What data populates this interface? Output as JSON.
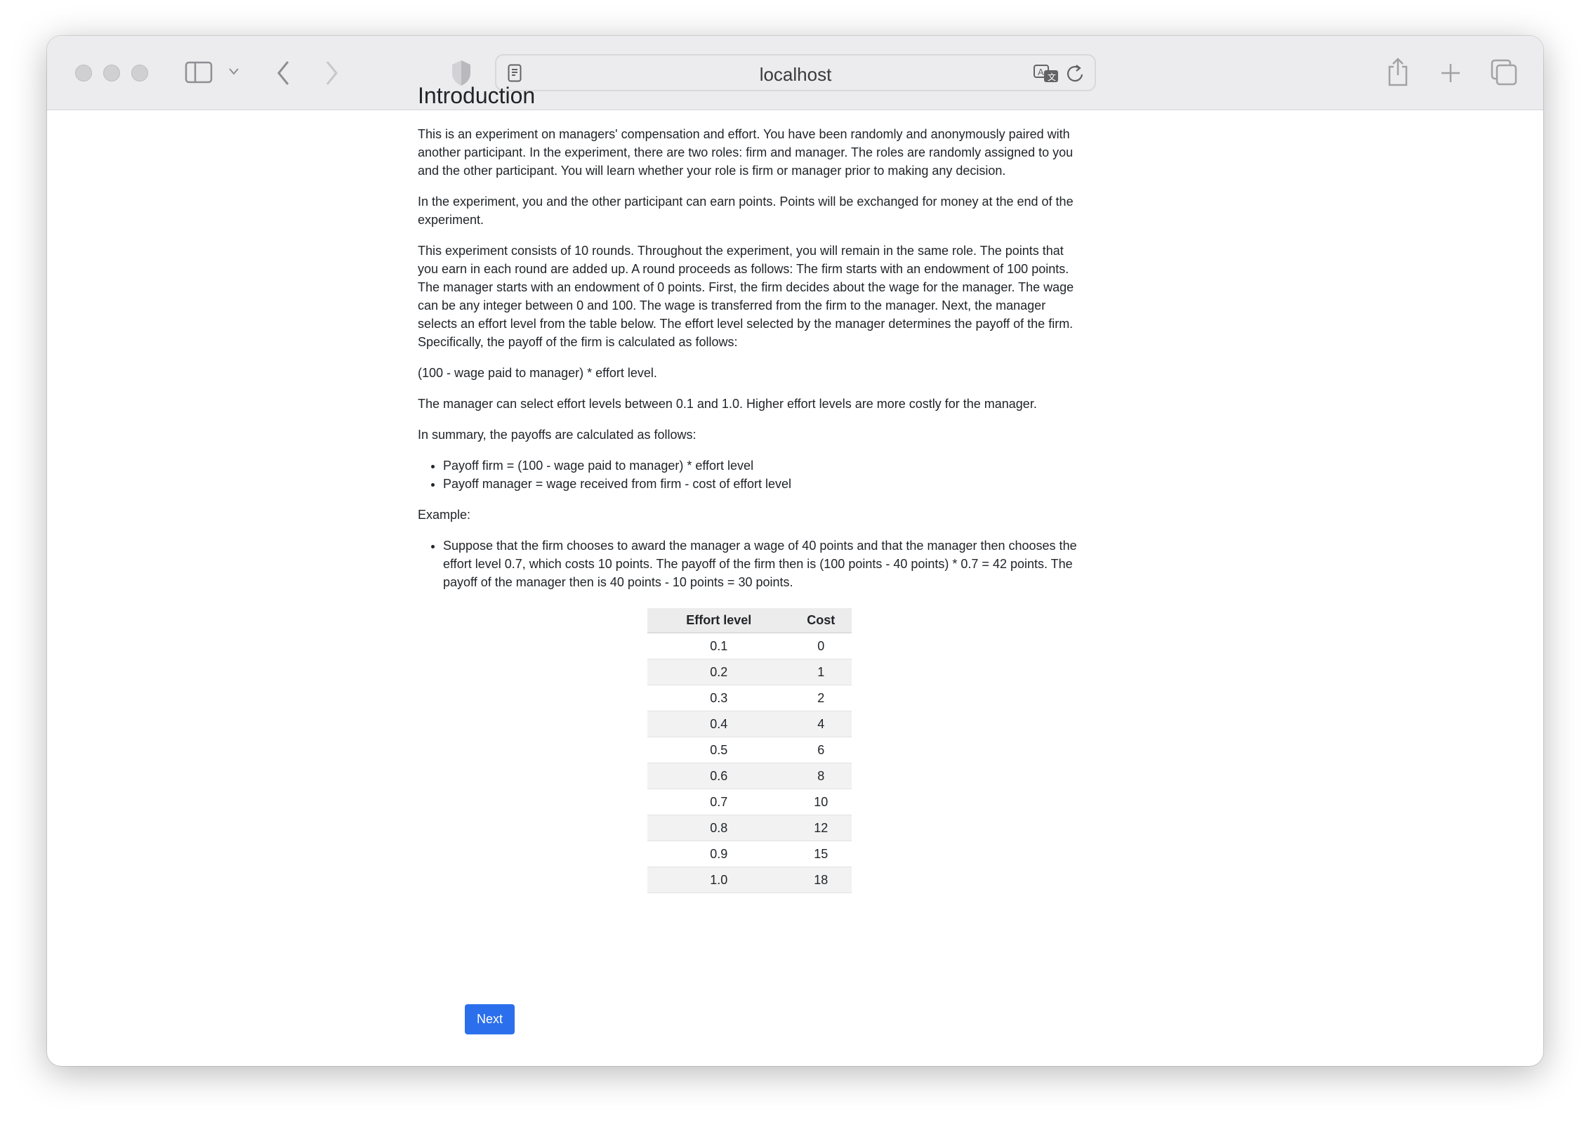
{
  "browser": {
    "url": "localhost",
    "icons": [
      "sidebar-icon",
      "chevron-down-icon",
      "back-icon",
      "forward-icon",
      "shield-icon",
      "reader-icon",
      "translate-icon",
      "reload-icon",
      "share-icon",
      "new-tab-icon",
      "tabs-overview-icon"
    ]
  },
  "page": {
    "title": "Introduction",
    "paragraphs": [
      "This is an experiment on managers' compensation and effort. You have been randomly and anonymously paired with another participant. In the experiment, there are two roles: firm and manager. The roles are randomly assigned to you and the other participant. You will learn whether your role is firm or manager prior to making any decision.",
      "In the experiment, you and the other participant can earn points. Points will be exchanged for money at the end of the experiment.",
      "This experiment consists of 10 rounds. Throughout the experiment, you will remain in the same role. The points that you earn in each round are added up. A round proceeds as follows: The firm starts with an endowment of 100 points. The manager starts with an endowment of 0 points. First, the firm decides about the wage for the manager. The wage can be any integer between 0 and 100. The wage is transferred from the firm to the manager. Next, the manager selects an effort level from the table below. The effort level selected by the manager determines the payoff of the firm. Specifically, the payoff of the firm is calculated as follows:",
      "(100 - wage paid to manager) * effort level.",
      "The manager can select effort levels between 0.1 and 1.0. Higher effort levels are more costly for the manager.",
      "In summary, the payoffs are calculated as follows:"
    ],
    "summary_items": [
      "Payoff firm = (100 - wage paid to manager) * effort level",
      "Payoff manager = wage received from firm - cost of effort level"
    ],
    "example_label": "Example:",
    "example_items": [
      "Suppose that the firm chooses to award the manager a wage of 40 points and that the manager then chooses the effort level 0.7, which costs 10 points. The payoff of the firm then is (100 points - 40 points) * 0.7 = 42 points. The payoff of the manager then is 40 points - 10 points = 30 points."
    ],
    "table": {
      "headers": [
        "Effort level",
        "Cost"
      ],
      "rows": [
        [
          "0.1",
          "0"
        ],
        [
          "0.2",
          "1"
        ],
        [
          "0.3",
          "2"
        ],
        [
          "0.4",
          "4"
        ],
        [
          "0.5",
          "6"
        ],
        [
          "0.6",
          "8"
        ],
        [
          "0.7",
          "10"
        ],
        [
          "0.8",
          "12"
        ],
        [
          "0.9",
          "15"
        ],
        [
          "1.0",
          "18"
        ]
      ]
    },
    "next_label": "Next",
    "accent_color": "#2b6fed"
  }
}
